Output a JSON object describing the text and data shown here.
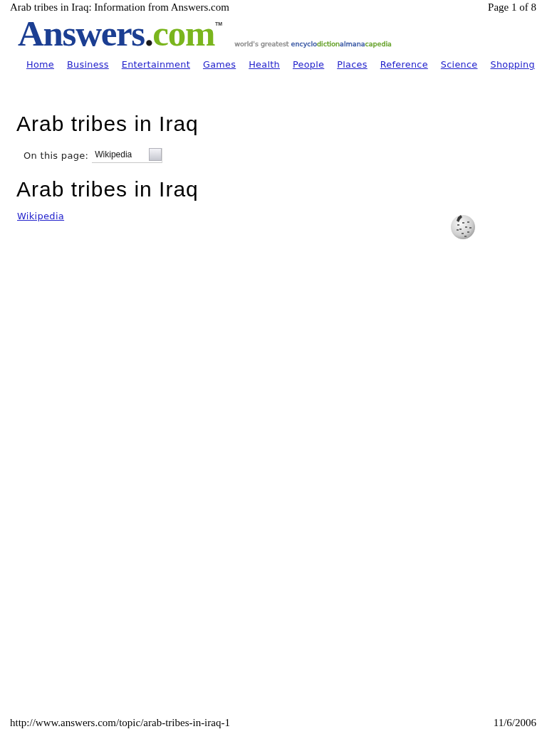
{
  "print_header": {
    "title": "Arab tribes in Iraq: Information from Answers.com",
    "page": "Page 1 of 8"
  },
  "logo": {
    "parts": [
      {
        "text": "Answers",
        "color": "#1b3e92"
      },
      {
        "text": ".",
        "color": "#1a1a1a"
      },
      {
        "text": "com",
        "color": "#7ab51d"
      }
    ],
    "trademark": "TM"
  },
  "tagline": {
    "parts": [
      {
        "text": "world's greatest ",
        "color": "#858585"
      },
      {
        "text": "encyclo",
        "color": "#2e4f9f"
      },
      {
        "text": "diction",
        "color": "#5c9c1c"
      },
      {
        "text": "almana",
        "color": "#2e4f9f"
      },
      {
        "text": "capedia",
        "color": "#5c9c1c"
      }
    ]
  },
  "nav": [
    "Home",
    "Business",
    "Entertainment",
    "Games",
    "Health",
    "People",
    "Places",
    "Reference",
    "Science",
    "Shopping"
  ],
  "title": "Arab tribes in Iraq",
  "on_this_page": {
    "label": "On this page:",
    "value": "Wikipedia"
  },
  "section": {
    "heading": "Arab tribes in Iraq",
    "source_link": "Wikipedia"
  },
  "print_footer": {
    "url": "http://www.answers.com/topic/arab-tribes-in-iraq-1",
    "date": "11/6/2006"
  }
}
